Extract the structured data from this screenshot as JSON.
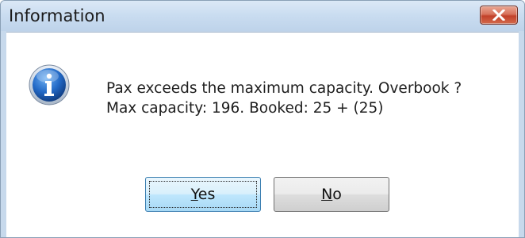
{
  "window": {
    "title": "Information"
  },
  "icon": {
    "name": "info-icon",
    "glyph": "i"
  },
  "message": {
    "line1": "Pax exceeds the maximum capacity. Overbook ?",
    "line2": "Max capacity: 196. Booked: 25 + (25)"
  },
  "buttons": {
    "yes": {
      "mnemonic": "Y",
      "rest": "es"
    },
    "no": {
      "mnemonic": "N",
      "rest": "o"
    }
  },
  "colors": {
    "title_bar": "#c9dcf0",
    "close_button": "#c2412a",
    "default_button": "#bee6fd",
    "info_icon": "#1d5eb0"
  }
}
